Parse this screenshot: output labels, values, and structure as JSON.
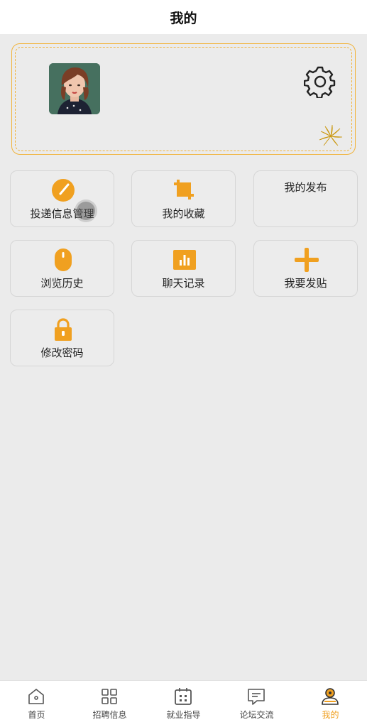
{
  "header": {
    "title": "我的"
  },
  "profile": {
    "avatar_alt": "avatar",
    "settings_icon": "gear-icon"
  },
  "menu": [
    {
      "label": "投递信息管理",
      "icon": "gauge-icon"
    },
    {
      "label": "我的收藏",
      "icon": "crop-icon"
    },
    {
      "label": "我的发布",
      "icon": "none"
    },
    {
      "label": "浏览历史",
      "icon": "mouse-icon"
    },
    {
      "label": "聊天记录",
      "icon": "bar-chart-icon"
    },
    {
      "label": "我要发贴",
      "icon": "plus-icon"
    },
    {
      "label": "修改密码",
      "icon": "lock-icon"
    }
  ],
  "tabbar": {
    "tabs": [
      {
        "label": "首页",
        "icon": "home-icon"
      },
      {
        "label": "招聘信息",
        "icon": "grid-icon"
      },
      {
        "label": "就业指导",
        "icon": "calendar-icon"
      },
      {
        "label": "论坛交流",
        "icon": "message-icon"
      },
      {
        "label": "我的",
        "icon": "user-icon",
        "active": true
      }
    ]
  },
  "colors": {
    "accent": "#f0a020",
    "card_border": "#f1b33b",
    "background": "#ebebeb"
  }
}
